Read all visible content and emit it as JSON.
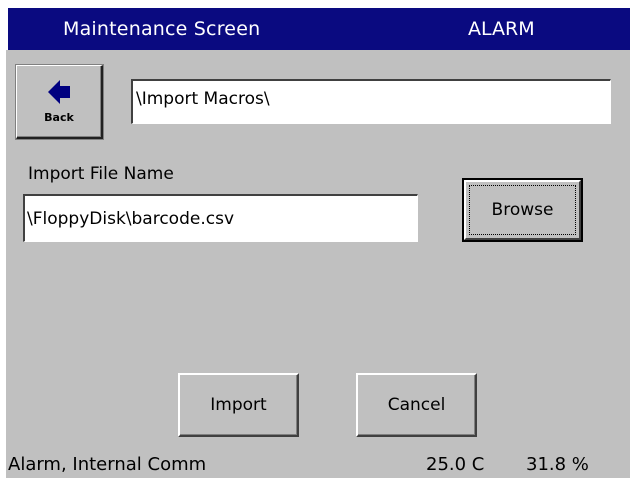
{
  "header": {
    "title": "Maintenance Screen",
    "alarm": "ALARM"
  },
  "back_button": {
    "label": "Back",
    "icon": "left-arrow-icon"
  },
  "path_field": {
    "value": "\\Import Macros\\"
  },
  "import_file": {
    "label": "Import File Name",
    "value": "\\FloppyDisk\\barcode.csv"
  },
  "buttons": {
    "browse": "Browse",
    "import": "Import",
    "cancel": "Cancel"
  },
  "status_bar": {
    "message": "Alarm, Internal Comm",
    "temperature": "25.0 C",
    "humidity": "31.8 %"
  },
  "colors": {
    "title_bar": "#0a0a80",
    "background": "#c0c0c0"
  }
}
